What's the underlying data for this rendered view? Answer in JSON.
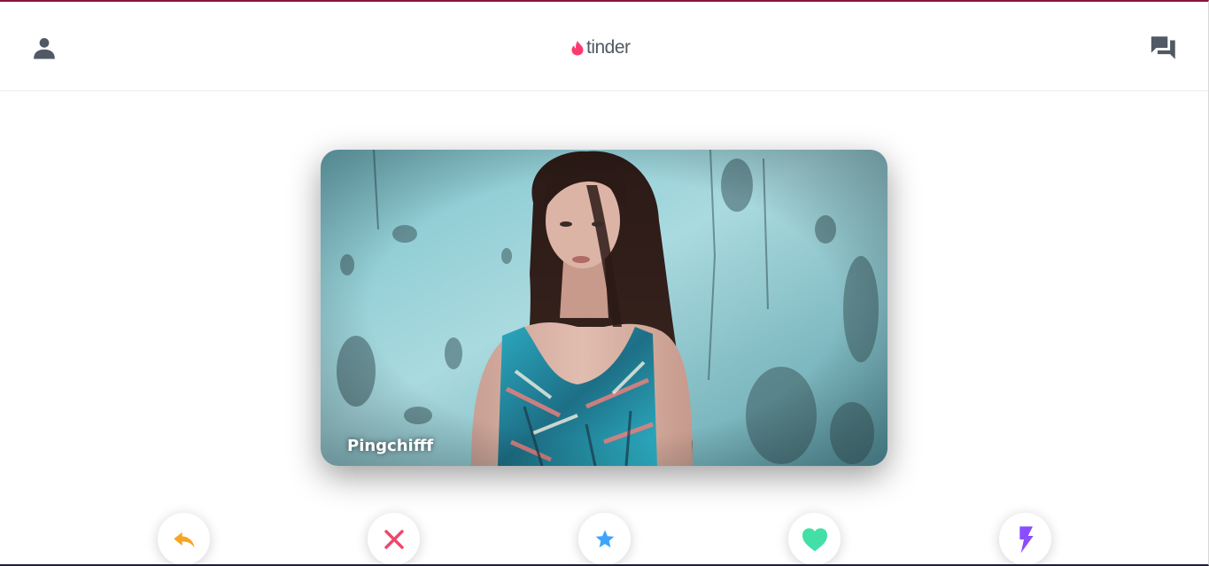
{
  "header": {
    "logo_text": "tinder",
    "profile_icon": "person-icon",
    "messages_icon": "chat-bubbles-icon"
  },
  "card": {
    "name": "Pingchifff"
  },
  "actions": [
    {
      "name": "rewind",
      "icon": "rewind-arrow-icon",
      "color": "#f5a623"
    },
    {
      "name": "nope",
      "icon": "close-icon",
      "color": "#f0466c"
    },
    {
      "name": "super-like",
      "icon": "star-icon",
      "color": "#3ca4ff"
    },
    {
      "name": "like",
      "icon": "heart-icon",
      "color": "#42e0a6"
    },
    {
      "name": "boost",
      "icon": "lightning-icon",
      "color": "#8a4dff"
    }
  ],
  "colors": {
    "brand": "#fd3a6f",
    "icon_gray": "#505965"
  }
}
